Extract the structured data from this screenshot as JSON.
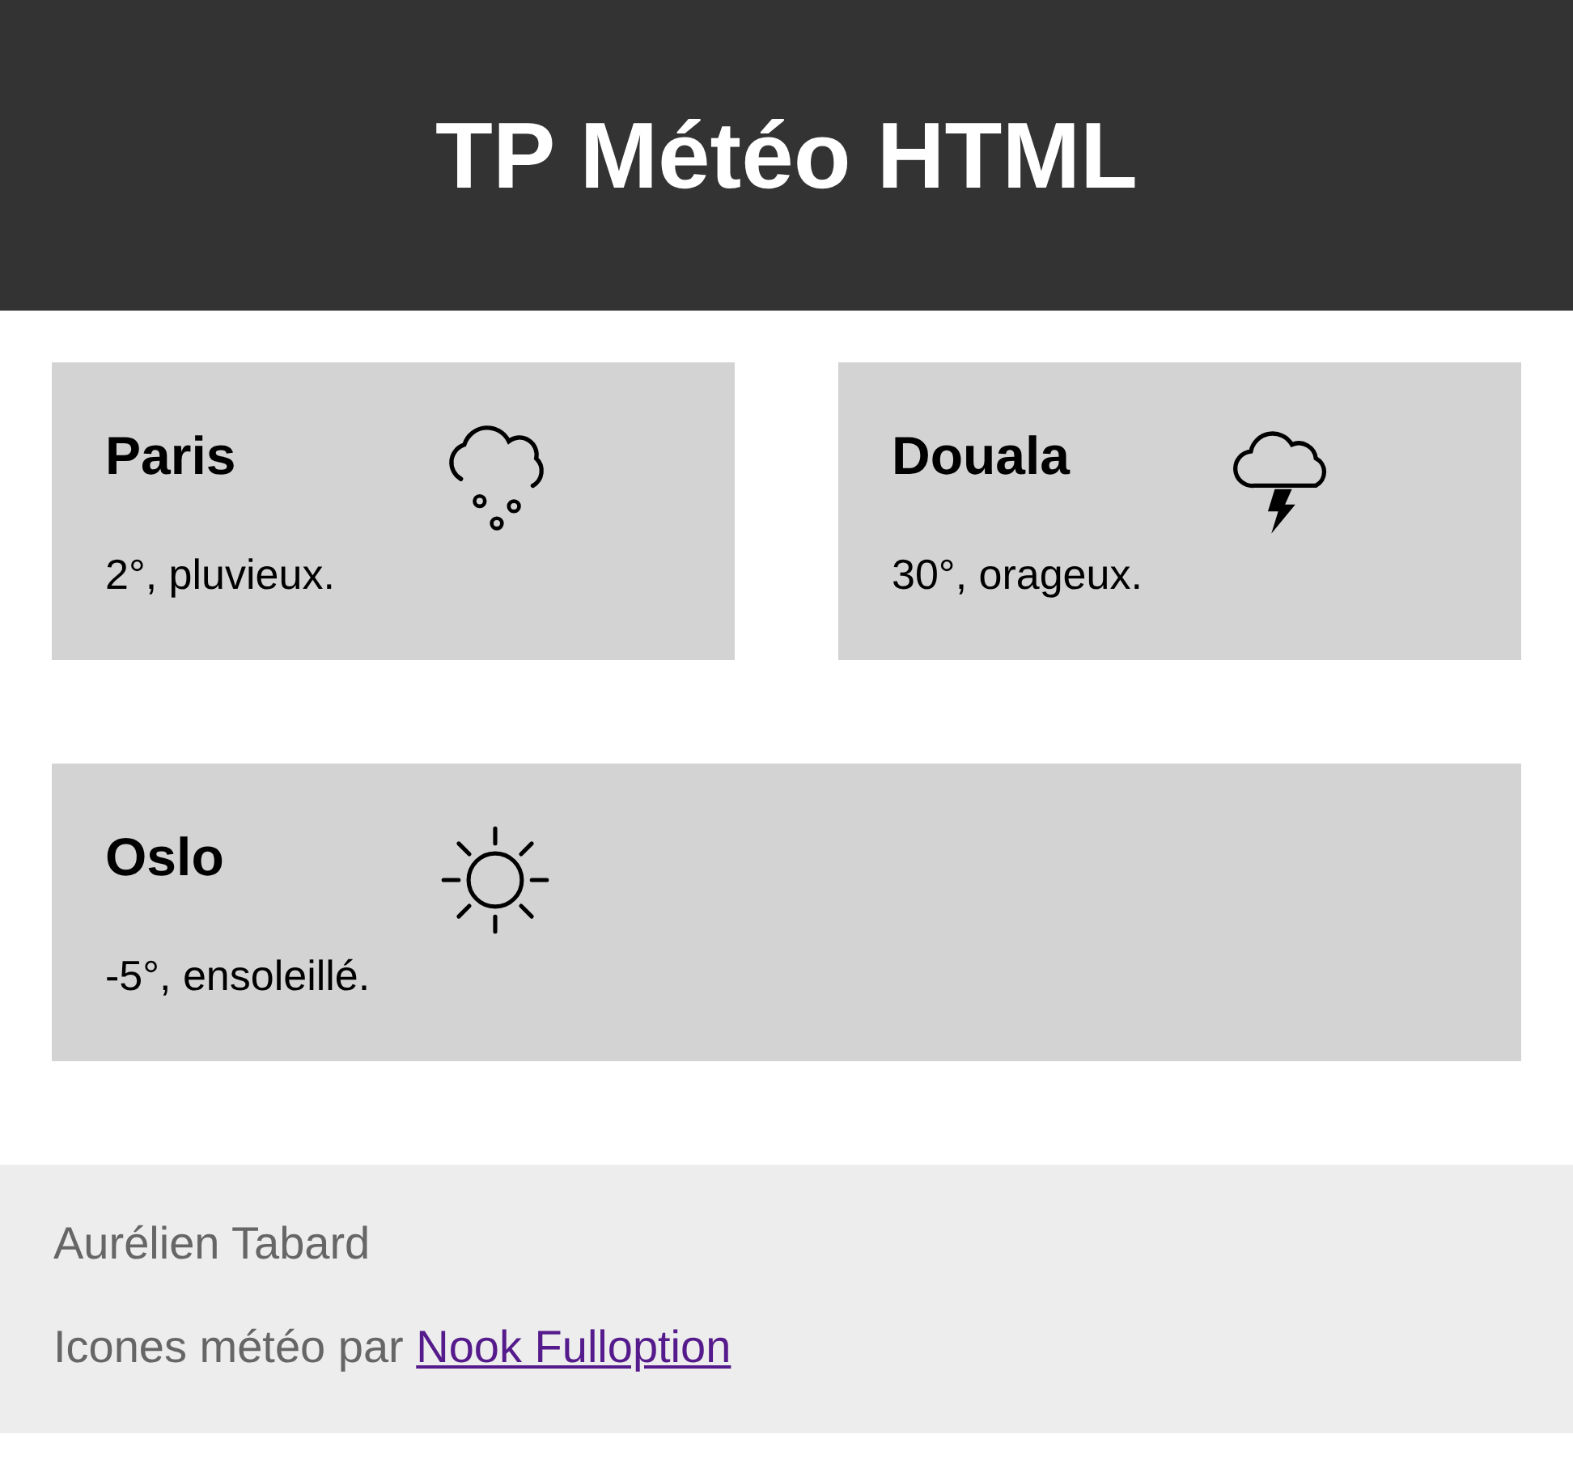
{
  "header": {
    "title": "TP Météo HTML"
  },
  "cities": [
    {
      "name": "Paris",
      "kind": "rain",
      "summary": "2°, pluvieux."
    },
    {
      "name": "Douala",
      "kind": "storm",
      "summary": "30°, orageux."
    },
    {
      "name": "Oslo",
      "kind": "sun",
      "summary": "-5°, ensoleillé."
    }
  ],
  "footer": {
    "author": "Aurélien Tabard",
    "credit": "Icones météo par ",
    "credit_link": "Nook Fulloption"
  }
}
